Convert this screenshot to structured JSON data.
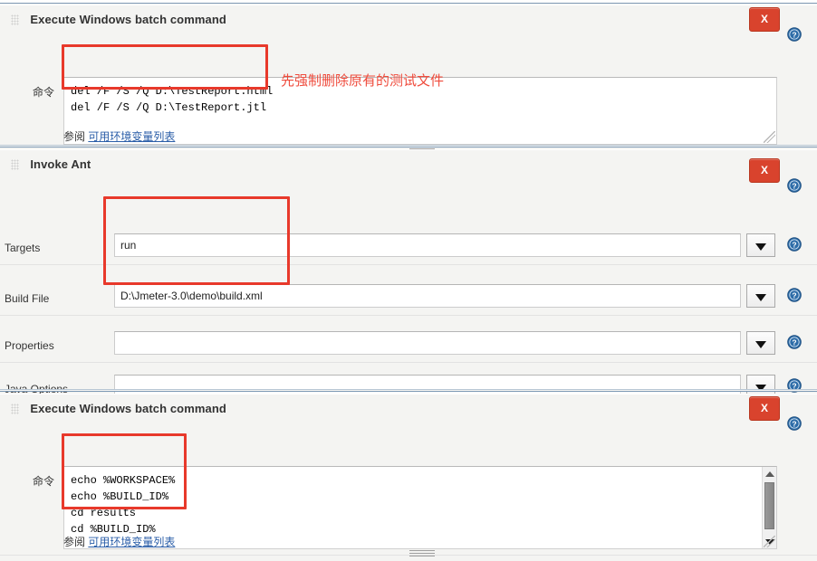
{
  "sections": [
    {
      "title": "Execute Windows batch command",
      "close_label": "X",
      "command_label": "命令",
      "command_value": "del /F /S /Q D:\\TestReport.html\ndel /F /S /Q D:\\TestReport.jtl",
      "reference_prefix": "参阅",
      "reference_link": "可用环境变量列表",
      "annotation": "先强制删除原有的测试文件"
    },
    {
      "title": "Invoke Ant",
      "close_label": "X",
      "fields": [
        {
          "label": "Targets",
          "value": "run",
          "dropdown": "▼"
        },
        {
          "label": "Build File",
          "value": "D:\\Jmeter-3.0\\demo\\build.xml",
          "dropdown": "▼"
        },
        {
          "label": "Properties",
          "value": "",
          "dropdown": "▼"
        },
        {
          "label": "Java Options",
          "value": "",
          "dropdown": "▼"
        }
      ]
    },
    {
      "title": "Execute Windows batch command",
      "close_label": "X",
      "command_label": "命令",
      "command_value": "echo %WORKSPACE%\necho %BUILD_ID%\ncd results\ncd %BUILD_ID%",
      "reference_prefix": "参阅",
      "reference_link": "可用环境变量列表"
    }
  ],
  "icons": {
    "help": "help-icon",
    "drag": "drag-handle-icon",
    "dropdown": "chevron-down-icon",
    "close": "close-icon"
  },
  "colors": {
    "close_red": "#d9432d",
    "help_blue": "#2d6ca8",
    "annotation_red": "#ef4b3c",
    "link_blue": "#2b5ea8",
    "separator_blue": "#7e9ab5",
    "panel_bg": "#f4f4f2"
  }
}
